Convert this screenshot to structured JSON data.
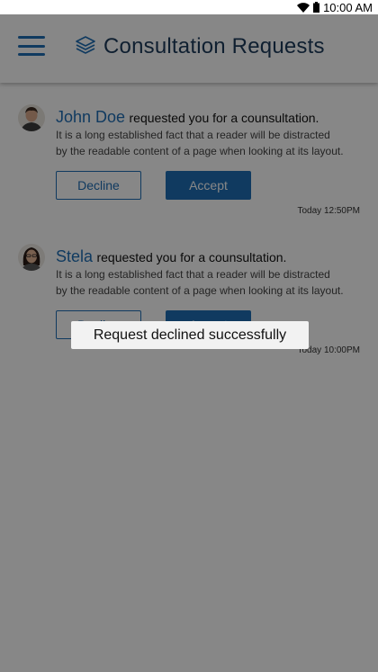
{
  "status_bar": {
    "time": "10:00 AM",
    "icons": [
      "wifi-icon",
      "battery-icon"
    ]
  },
  "app_bar": {
    "menu_icon": "menu-icon",
    "title_icon": "layers-icon",
    "title": "Consultation Requests"
  },
  "requests": [
    {
      "name": "John Doe",
      "message": "requested you for a counsultation.",
      "description": "It is a long established fact that a reader will be distracted by the readable content of a page when looking at its layout.",
      "decline_label": "Decline",
      "accept_label": "Accept",
      "time": "Today 12:50PM"
    },
    {
      "name": "Stela",
      "message": "requested you for a counsultation.",
      "description": "It is a long established fact that a reader will be distracted by the readable content of a page when looking at its layout.",
      "decline_label": "Decline",
      "accept_label": "Accept",
      "time": "Today 10:00PM"
    }
  ],
  "toast": {
    "message": "Request declined successfully"
  },
  "colors": {
    "accent": "#1f6fb5",
    "title": "#1d3c5c",
    "overlay": "rgba(0,0,0,0.47)",
    "toast_bg": "#f2f2f2"
  }
}
